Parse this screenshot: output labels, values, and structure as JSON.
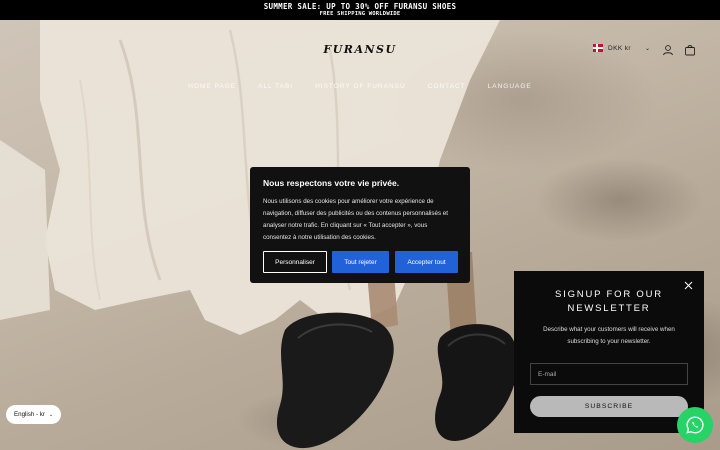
{
  "announcement": {
    "line1": "SUMMER SALE: UP TO 30% OFF FURANSU SHOES",
    "line2": "FREE SHIPPING WORLDWIDE"
  },
  "header": {
    "logo": "FURANSU",
    "currency": "DKK kr",
    "icons": [
      "flag-dk-icon",
      "chevron-down-icon",
      "user-icon",
      "cart-bag-icon"
    ]
  },
  "nav": {
    "items": [
      "HOME PAGE",
      "ALL TABI",
      "HISTORY OF FURANSU",
      "CONTACT",
      "LANGUAGE"
    ]
  },
  "cookie": {
    "title": "Nous respectons votre vie privée.",
    "body": "Nous utilisons des cookies pour améliorer votre expérience de navigation, diffuser des publicités ou des contenus personnalisés et analyser notre trafic. En cliquant sur « Tout accepter », vous consentez à notre utilisation des cookies.",
    "customize_label": "Personnaliser",
    "reject_label": "Tout rejeter",
    "accept_label": "Accepter tout",
    "accent_color": "#2262d9"
  },
  "newsletter": {
    "title": "SIGNUP FOR OUR NEWSLETTER",
    "description": "Describe what your customers will receive when subscribing to your newsletter.",
    "email_placeholder": "E-mail",
    "subscribe_label": "SUBSCRIBE",
    "close_icon": "close-icon"
  },
  "language_selector": {
    "label": "English - kr"
  },
  "whatsapp": {
    "icon": "whatsapp-icon",
    "color": "#25d366"
  }
}
